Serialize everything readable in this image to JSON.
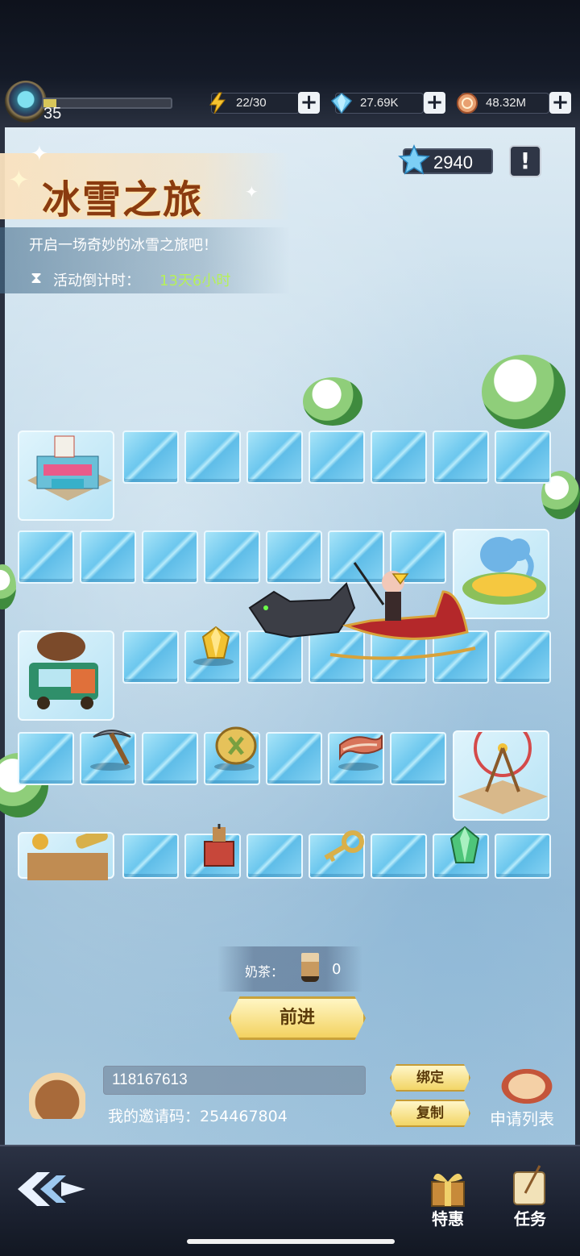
{
  "player": {
    "level": "35",
    "xp_progress": 0.1
  },
  "resources": {
    "energy": {
      "value": "22/30",
      "icon": "lightning-icon"
    },
    "diamonds": {
      "value": "27.69K",
      "icon": "diamond-icon"
    },
    "coins": {
      "value": "48.32M",
      "icon": "coin-icon"
    }
  },
  "event": {
    "title": "冰雪之旅",
    "description": "开启一场奇妙的冰雪之旅吧！",
    "countdown_label": "活动倒计时：",
    "countdown_value": "13天6小时",
    "stars": "2940",
    "info_label": "!"
  },
  "board": {
    "rows": 5,
    "items": [
      "pickaxe-icon",
      "coin-clover-icon",
      "bacon-icon",
      "crystal-gold-icon",
      "tnt-icon",
      "key-icon",
      "crystal-green-icon"
    ]
  },
  "milk_tea": {
    "label": "奶茶：",
    "count": "0"
  },
  "forward_button": "前进",
  "invite": {
    "input_value": "118167613",
    "my_code_label": "我的邀请码：254467804",
    "bind_button": "绑定",
    "copy_button": "复制",
    "apply_list_label": "申请列表"
  },
  "bottom_tabs": {
    "special_offer": "特惠",
    "tasks": "任务"
  },
  "colors": {
    "accent_gold": "#f3d260",
    "ice": "#6cc7ee",
    "countdown": "#b6f05a"
  }
}
